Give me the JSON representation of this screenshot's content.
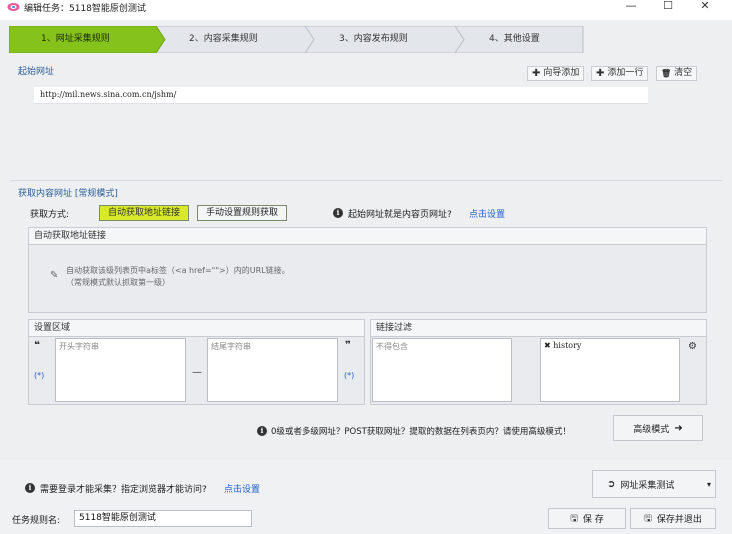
{
  "window": {
    "title": "编辑任务：5118智能原创测试",
    "minimize": "—",
    "maximize": "☐",
    "close": "✕"
  },
  "steps": [
    {
      "label": "1、网址采集规则",
      "active": true
    },
    {
      "label": "2、内容采集规则",
      "active": false
    },
    {
      "label": "3、内容发布规则",
      "active": false
    },
    {
      "label": "4、其他设置",
      "active": false
    }
  ],
  "start_url": {
    "label": "起始网址",
    "wizard_add": "向导添加",
    "add_line": "添加一行",
    "clear": "清空",
    "url": "http://mil.news.sina.com.cn/jshm/"
  },
  "content_url": {
    "label": "获取内容网址 [常规模式]",
    "method_label": "获取方式:",
    "auto_btn": "自动获取地址链接",
    "manual_btn": "手动设置规则获取",
    "question": "起始网址就是内容页网址?",
    "question_link": "点击设置"
  },
  "auto_panel": {
    "title": "自动获取地址链接",
    "hint_line1": "自动获取该级列表页中a标签（<a href=\"\">）内的URL链接。",
    "hint_line2": "（常规模式默认抓取第一级）"
  },
  "region_panel": {
    "title": "设置区域",
    "open_quote": "❝",
    "close_quote": "❞",
    "star_left": "(*)",
    "star_right": "(*)",
    "dash": "—",
    "start_placeholder": "开头字符串",
    "end_placeholder": "结尾字符串"
  },
  "filter_panel": {
    "title": "链接过滤",
    "exclude_placeholder": "不得包含",
    "filter_item": "history",
    "remove_icon": "✖",
    "gear": "⚙"
  },
  "advanced": {
    "notice": "0级或者多级网址？POST获取网址？提取的数据在列表页内？请使用高级模式！",
    "button": "高级模式"
  },
  "login": {
    "notice": "需要登录才能采集？指定浏览器才能访问?",
    "link": "点击设置"
  },
  "test_button": {
    "label": "网址采集测试",
    "dropdown": "▾"
  },
  "task": {
    "name_label": "任务规则名:",
    "name_value": "5118智能原创测试",
    "save": "保 存",
    "save_exit": "保存并退出"
  },
  "colors": {
    "active_step": "#86c21c",
    "highlight_toggle": "#d6ea2a",
    "link": "#1d5fc8",
    "group_label": "#2a5e9a"
  }
}
